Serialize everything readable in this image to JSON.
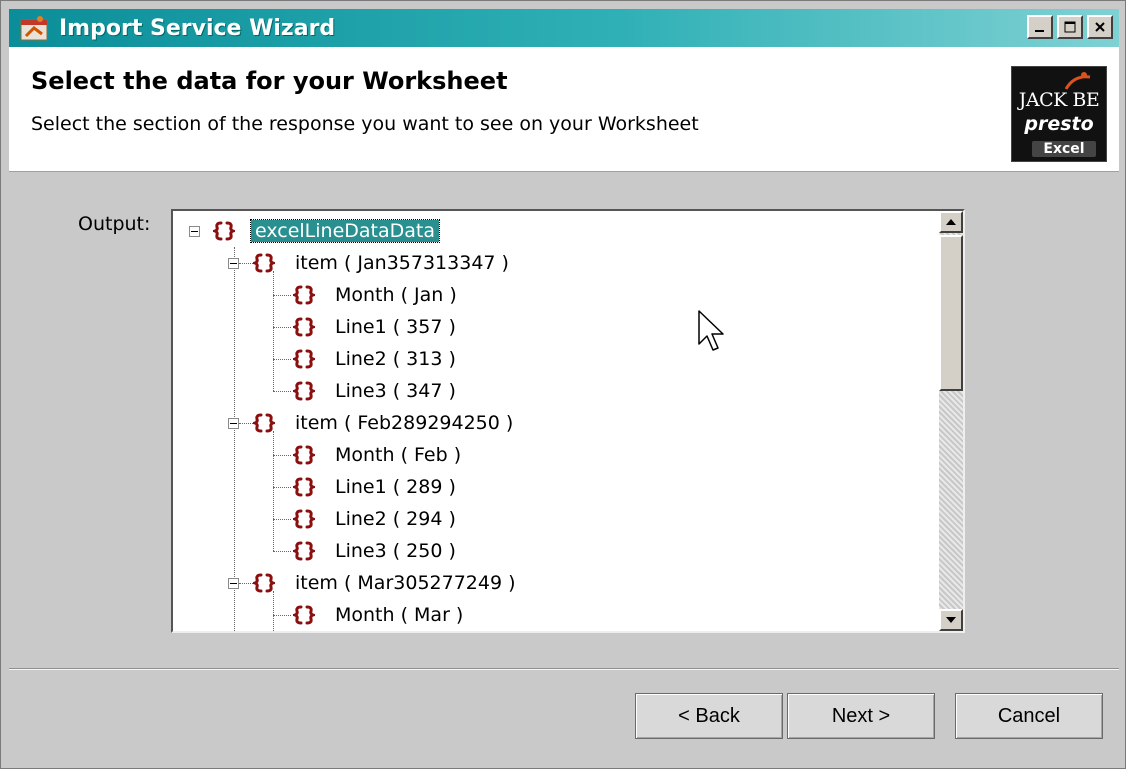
{
  "window": {
    "title": "Import Service Wizard",
    "controls": [
      "minimize-icon",
      "maximize-icon",
      "close-icon"
    ]
  },
  "header": {
    "heading": "Select the data for your Worksheet",
    "subheading": "Select the section of the response you want to see on your Worksheet",
    "logo": {
      "brand": "JACK BE",
      "product": "presto",
      "sub": "Excel"
    }
  },
  "output": {
    "label": "Output:",
    "tree": [
      {
        "label": "excelLineDataData",
        "depth": 0,
        "expander": true,
        "selected": true
      },
      {
        "label": "item ( Jan357313347 )",
        "depth": 1,
        "expander": true
      },
      {
        "label": "Month ( Jan )",
        "depth": 2
      },
      {
        "label": "Line1 ( 357 )",
        "depth": 2
      },
      {
        "label": "Line2 ( 313 )",
        "depth": 2
      },
      {
        "label": "Line3 ( 347 )",
        "depth": 2
      },
      {
        "label": "item ( Feb289294250 )",
        "depth": 1,
        "expander": true
      },
      {
        "label": "Month ( Feb )",
        "depth": 2
      },
      {
        "label": "Line1 ( 289 )",
        "depth": 2
      },
      {
        "label": "Line2 ( 294 )",
        "depth": 2
      },
      {
        "label": "Line3 ( 250 )",
        "depth": 2
      },
      {
        "label": "item ( Mar305277249 )",
        "depth": 1,
        "expander": true
      },
      {
        "label": "Month ( Mar )",
        "depth": 2
      }
    ]
  },
  "buttons": {
    "back": "< Back",
    "next": "Next >",
    "cancel": "Cancel"
  },
  "colors": {
    "titlebar": "#0b8e99",
    "selection": "#2a8f8f",
    "node_icon": "#8b0f0f"
  }
}
